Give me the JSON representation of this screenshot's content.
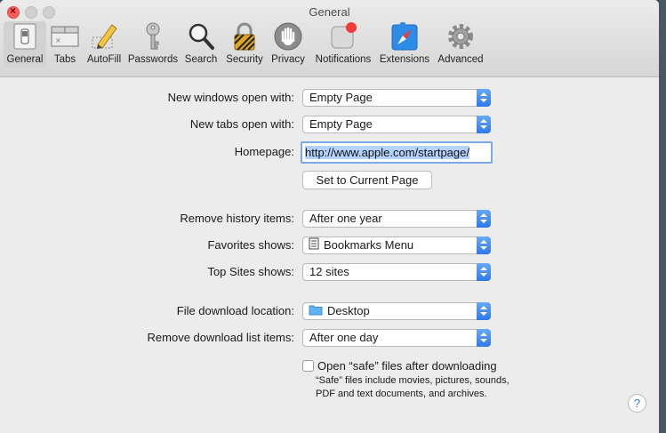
{
  "window": {
    "title": "General"
  },
  "toolbar": [
    {
      "label": "General",
      "icon": "general-switch-icon"
    },
    {
      "label": "Tabs",
      "icon": "tabs-icon"
    },
    {
      "label": "AutoFill",
      "icon": "autofill-pencil-icon"
    },
    {
      "label": "Passwords",
      "icon": "key-icon"
    },
    {
      "label": "Search",
      "icon": "magnifier-icon"
    },
    {
      "label": "Security",
      "icon": "padlock-icon"
    },
    {
      "label": "Privacy",
      "icon": "hand-icon"
    },
    {
      "label": "Notifications",
      "icon": "notification-badge-icon"
    },
    {
      "label": "Extensions",
      "icon": "extensions-compass-icon"
    },
    {
      "label": "Advanced",
      "icon": "gear-icon"
    }
  ],
  "settings": {
    "new_windows": {
      "label": "New windows open with:",
      "value": "Empty Page"
    },
    "new_tabs": {
      "label": "New tabs open with:",
      "value": "Empty Page"
    },
    "homepage": {
      "label": "Homepage:",
      "value": "http://www.apple.com/startpage/"
    },
    "set_current_button": "Set to Current Page",
    "remove_history": {
      "label": "Remove history items:",
      "value": "After one year"
    },
    "favorites": {
      "label": "Favorites shows:",
      "value": "Bookmarks Menu",
      "icon": "bookmarks-list-icon"
    },
    "top_sites": {
      "label": "Top Sites shows:",
      "value": "12 sites"
    },
    "download_location": {
      "label": "File download location:",
      "value": "Desktop",
      "icon": "folder-icon"
    },
    "remove_downloads": {
      "label": "Remove download list items:",
      "value": "After one day"
    },
    "open_safe": {
      "label": "Open “safe” files after downloading",
      "checked": false
    },
    "safe_note": "“Safe” files include movies, pictures, sounds, PDF and text documents, and archives."
  },
  "help_label": "?"
}
